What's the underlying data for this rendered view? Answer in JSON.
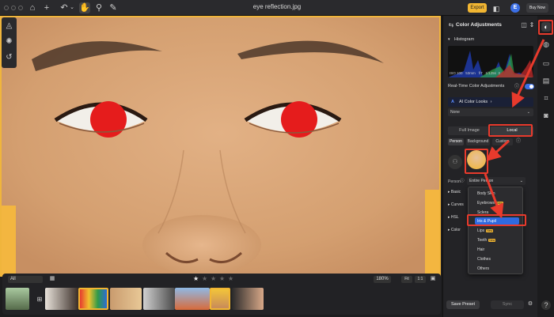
{
  "window": {
    "title": "eye reflection.jpg",
    "export_label": "Export",
    "avatar_letter": "E",
    "buy_label": "Buy Now"
  },
  "panel": {
    "title": "Color Adjustments",
    "histogram_label": "Histogram",
    "hist_info": [
      "ISO 100",
      "53mm",
      "f/7",
      "1/125s",
      "3"
    ],
    "realtime_label": "Real-Time Color Adjustments",
    "ai_looks_label": "AI Color Looks",
    "none_label": "None",
    "tabs": [
      "Full Image",
      "Local"
    ],
    "subtabs": [
      "Person",
      "Background",
      "Custom"
    ],
    "person_label": "Person",
    "person_dropdown": "Entire Person",
    "accordions": [
      "Basic",
      "Curves",
      "HSL",
      "Color"
    ],
    "dropdown_items": [
      "Body Skin",
      "Eyebrows",
      "Sclera",
      "Iris & Pupil",
      "Lips",
      "Teeth",
      "Hair",
      "Clothes",
      "Others"
    ],
    "badge_new": "New",
    "save_preset": "Save Preset",
    "sync": "Sync"
  },
  "filmstrip": {
    "filter": "All",
    "zoom": "180%",
    "fit": "Fit",
    "one": "1:1",
    "rating": 1
  },
  "colors": {
    "accent": "#f2b632",
    "selection": "#2f6ae0",
    "highlight": "#e83a2c",
    "pupil": "#e51c1c"
  }
}
